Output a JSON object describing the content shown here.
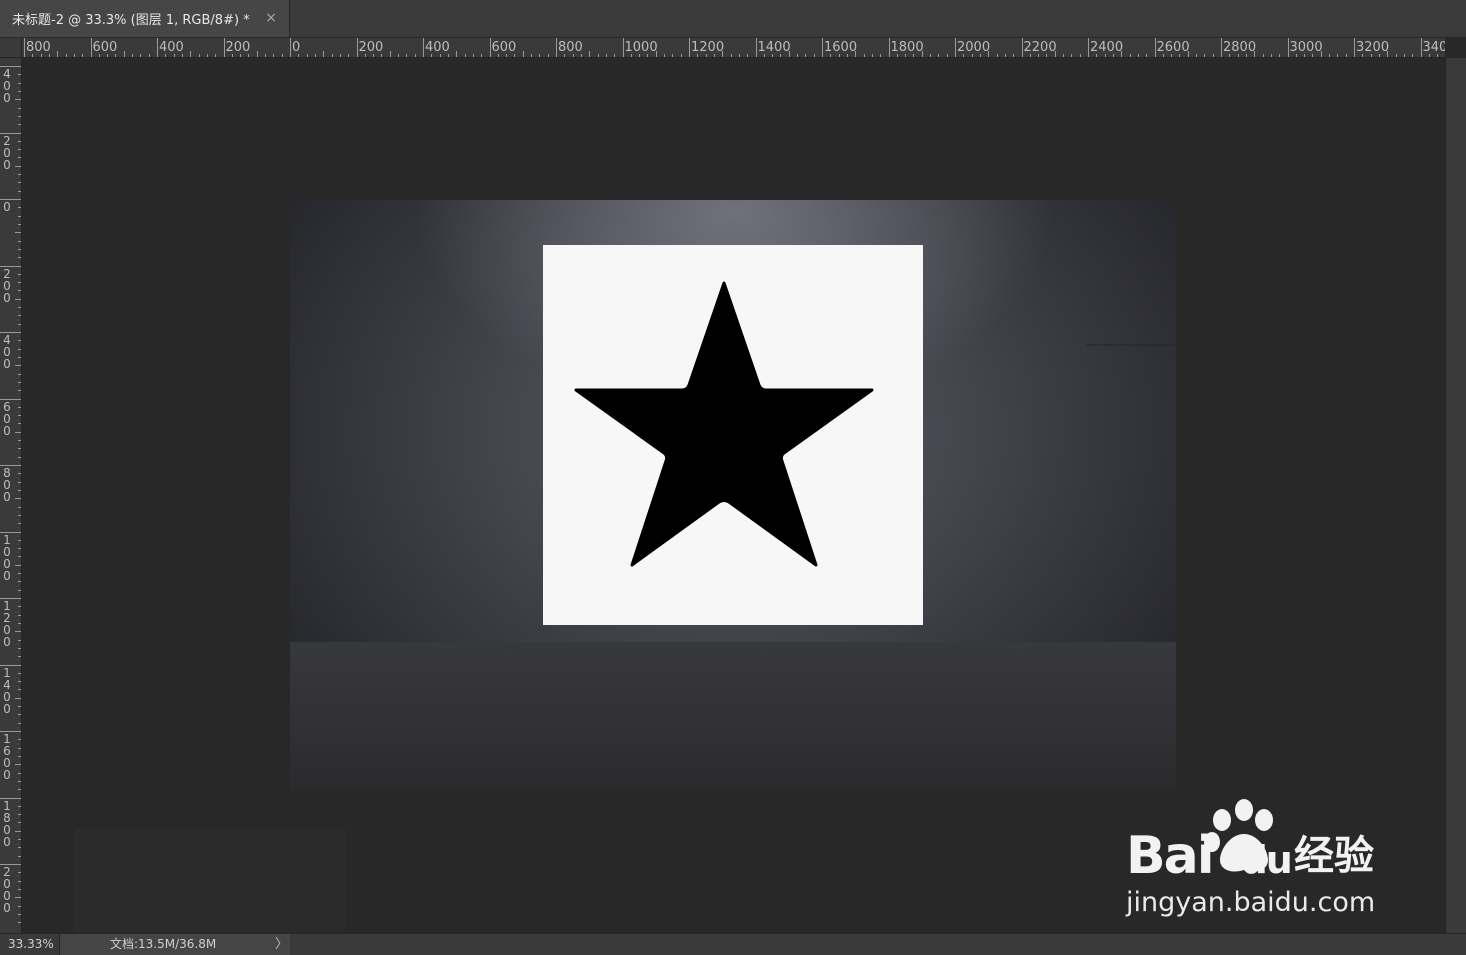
{
  "document_tab": {
    "title": "未标题-2 @ 33.3% (图层 1, RGB/8#) *",
    "close_glyph": "×"
  },
  "ruler_top_labels": [
    "800",
    "600",
    "400",
    "200",
    "0",
    "200",
    "400",
    "600",
    "800",
    "1000",
    "1200",
    "1400",
    "1600",
    "1800",
    "2000",
    "2200",
    "2400",
    "2600",
    "2800",
    "3000",
    "3200",
    "340"
  ],
  "ruler_left_labels": [
    "400",
    "200",
    "0",
    "200",
    "400",
    "600",
    "800",
    "1000",
    "1200",
    "1400",
    "1600",
    "1800",
    "2000"
  ],
  "canvas": {
    "shape": "five-point-star",
    "shape_color": "#000000",
    "layer_color": "#f7f7f7"
  },
  "status_bar": {
    "zoom": "33.33%",
    "doc_info": "文档:13.5M/36.8M",
    "arrow_glyph": "〉"
  },
  "watermark": {
    "brand": "Bai",
    "brand_tail": "du",
    "tag": "经验",
    "url": "jingyan.baidu.com"
  }
}
